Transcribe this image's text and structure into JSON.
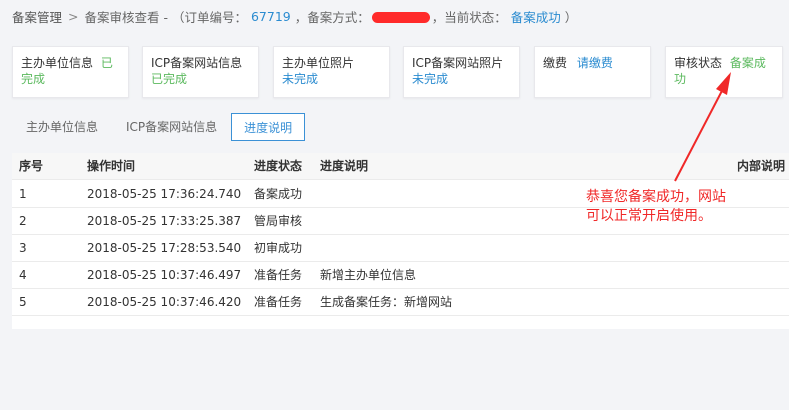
{
  "breadcrumb": {
    "root": "备案管理",
    "separator": ">",
    "current_prefix": "备案审核查看 - （订单编号：",
    "order_no": "67719",
    "method_label": "，备案方式：",
    "state_label": "，当前状态：",
    "state_value": "备案成功",
    "suffix": "）"
  },
  "cards": [
    {
      "label": "主办单位信息",
      "value": "已完成",
      "tone": "green"
    },
    {
      "label": "ICP备案网站信息",
      "value": "已完成",
      "tone": "green"
    },
    {
      "label": "主办单位照片",
      "value": "未完成",
      "tone": "blue"
    },
    {
      "label": "ICP备案网站照片",
      "value": "未完成",
      "tone": "blue"
    },
    {
      "label": "缴费",
      "value": "请缴费",
      "tone": "blue"
    },
    {
      "label": "审核状态",
      "value": "备案成功",
      "tone": "green"
    }
  ],
  "tabs": [
    {
      "label": "主办单位信息",
      "active": false
    },
    {
      "label": "ICP备案网站信息",
      "active": false
    },
    {
      "label": "进度说明",
      "active": true
    }
  ],
  "table": {
    "headers": [
      "序号",
      "操作时间",
      "进度状态",
      "进度说明",
      "内部说明"
    ],
    "rows": [
      [
        "1",
        "2018-05-25 17:36:24.740",
        "备案成功",
        "",
        ""
      ],
      [
        "2",
        "2018-05-25 17:33:25.387",
        "管局审核",
        "",
        ""
      ],
      [
        "3",
        "2018-05-25 17:28:53.540",
        "初审成功",
        "",
        ""
      ],
      [
        "4",
        "2018-05-25 10:37:46.497",
        "准备任务",
        "新增主办单位信息",
        ""
      ],
      [
        "5",
        "2018-05-25 10:37:46.420",
        "准备任务",
        "生成备案任务：新增网站",
        ""
      ]
    ]
  },
  "annotation": {
    "line1": "恭喜您备案成功，网站",
    "line2": "可以正常开启使用。"
  },
  "colors": {
    "green": "#5bb95e",
    "blue": "#2a8bd0",
    "annotation_red": "#f02828"
  }
}
